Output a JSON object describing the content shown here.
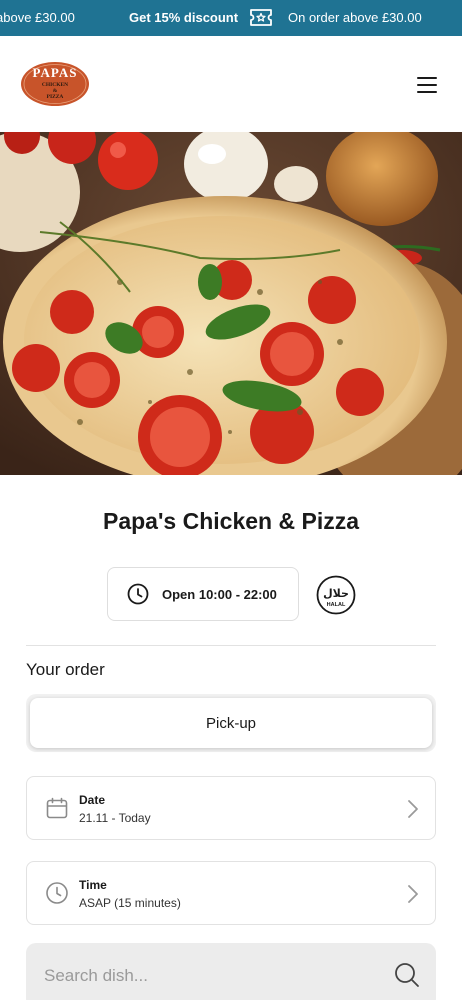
{
  "promo": {
    "segment_left": "above £30.00",
    "segment_center": "Get 15% discount",
    "segment_right": "On order above £30.00",
    "background_color": "#1f7393",
    "icon": "ticket-icon"
  },
  "header": {
    "logo": {
      "line1": "PAPAS",
      "line2": "CHICKEN",
      "line3": "&",
      "line4": "PIZZA",
      "color": "#c8542a"
    },
    "menu_icon": "hamburger-menu-icon"
  },
  "restaurant": {
    "name": "Papa's Chicken & Pizza",
    "hours": "Open 10:00 - 22:00",
    "halal_badge": {
      "arabic": "حلال",
      "latin": "HALAL"
    }
  },
  "order": {
    "heading": "Your order",
    "mode_selected": "Pick-up",
    "date": {
      "label": "Date",
      "value": "21.11 - Today",
      "icon": "calendar-icon"
    },
    "time": {
      "label": "Time",
      "value": "ASAP (15 minutes)",
      "icon": "clock-icon"
    }
  },
  "search": {
    "placeholder": "Search dish...",
    "icon": "search-icon"
  }
}
